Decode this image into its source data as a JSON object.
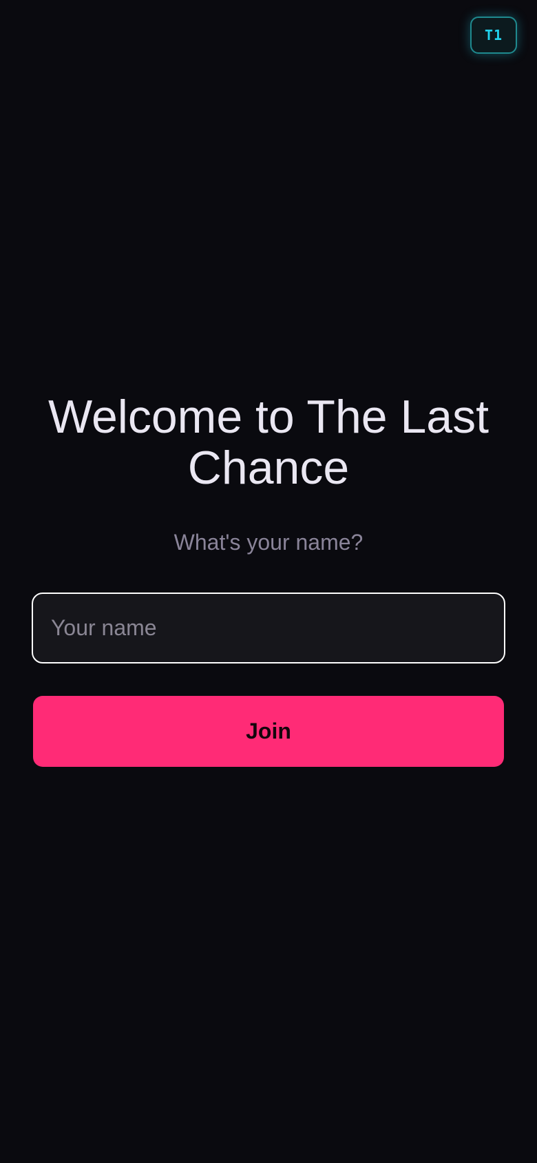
{
  "header": {
    "badge_label": "T1"
  },
  "welcome": {
    "title": "Welcome to The Last Chance",
    "prompt": "What's your name?"
  },
  "form": {
    "name_value": "",
    "name_placeholder": "Your name",
    "join_label": "Join"
  },
  "colors": {
    "background": "#0a0a0f",
    "accent": "#ff2b76",
    "badge": "#22d3ee",
    "title_text": "#eae7f2",
    "muted_text": "#8a8499"
  }
}
